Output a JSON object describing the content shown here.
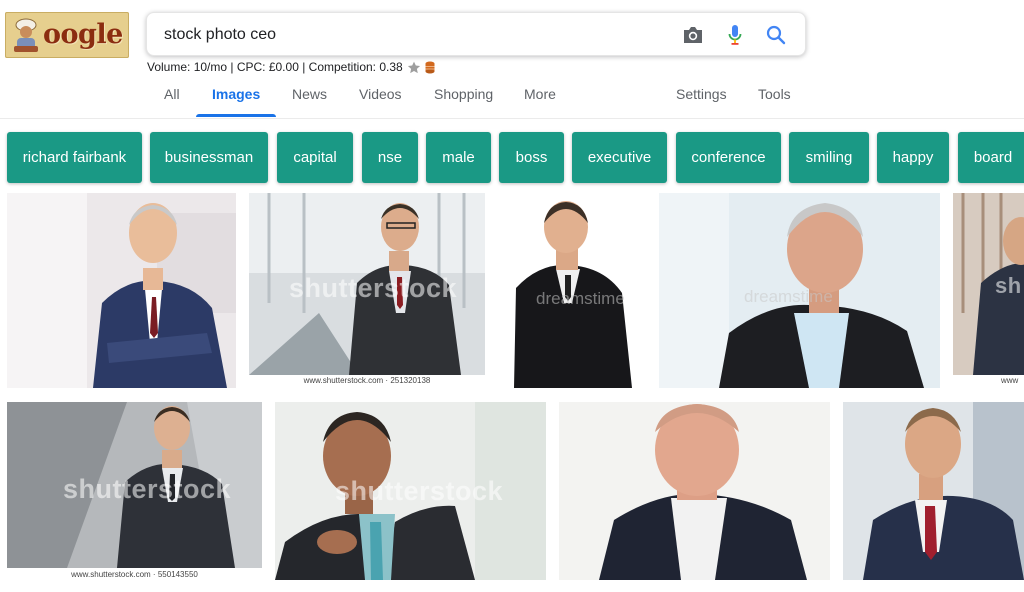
{
  "logo": {
    "text": "oogle"
  },
  "search": {
    "query": "stock photo ceo",
    "camera_icon": "camera-icon",
    "mic_icon": "microphone-icon",
    "search_icon": "magnifier-icon"
  },
  "seo_bar": {
    "text": "Volume: 10/mo | CPC: £0.00 | Competition: 0.38",
    "star_icon": "star-icon",
    "db_icon": "database-icon"
  },
  "tabs": [
    {
      "label": "All"
    },
    {
      "label": "Images",
      "active": true
    },
    {
      "label": "News"
    },
    {
      "label": "Videos"
    },
    {
      "label": "Shopping"
    },
    {
      "label": "More"
    },
    {
      "label": "Settings"
    },
    {
      "label": "Tools"
    }
  ],
  "chips": [
    "richard fairbank",
    "businessman",
    "capital",
    "nse",
    "male",
    "boss",
    "executive",
    "conference",
    "smiling",
    "happy",
    "board"
  ],
  "images": [
    {
      "watermark": ""
    },
    {
      "watermark": "shutterstock",
      "credit": "www.shutterstock.com · 251320138"
    },
    {
      "watermark": "dreamstime"
    },
    {
      "watermark": "dreamstime"
    },
    {
      "watermark": "sh",
      "credit": "www"
    },
    {
      "watermark": "shutterstock",
      "credit": "www.shutterstock.com · 550143550"
    },
    {
      "watermark": "shutterstock"
    },
    {
      "watermark": ""
    },
    {
      "watermark": ""
    }
  ],
  "colors": {
    "accent": "#1a73e8",
    "chip_bg": "#1a9985",
    "logo_bg": "#e6cf8e"
  }
}
